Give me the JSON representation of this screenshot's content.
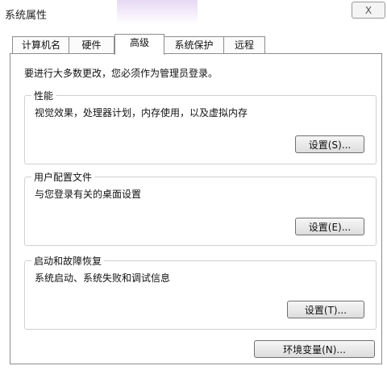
{
  "window": {
    "title": "系统属性",
    "close_glyph": "X"
  },
  "tabs": [
    {
      "label": "计算机名"
    },
    {
      "label": "硬件"
    },
    {
      "label": "高级",
      "active": true
    },
    {
      "label": "系统保护"
    },
    {
      "label": "远程"
    }
  ],
  "notice": "要进行大多数更改，您必须作为管理员登录。",
  "groups": {
    "performance": {
      "title": "性能",
      "desc": "视觉效果，处理器计划，内存使用，以及虚拟内存",
      "button": "设置(S)..."
    },
    "profiles": {
      "title": "用户配置文件",
      "desc": "与您登录有关的桌面设置",
      "button": "设置(E)..."
    },
    "startup": {
      "title": "启动和故障恢复",
      "desc": "系统启动、系统失败和调试信息",
      "button": "设置(T)..."
    }
  },
  "env_button": "环境变量(N)..."
}
